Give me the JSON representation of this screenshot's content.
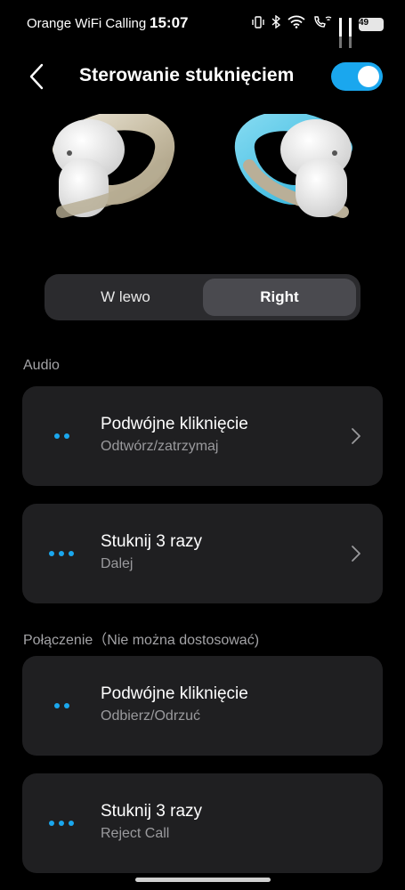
{
  "status_bar": {
    "carrier": "Orange WiFi Calling",
    "time": "15:07",
    "battery": "49"
  },
  "header": {
    "title": "Sterowanie stuknięciem",
    "toggle_on": true
  },
  "segmented": {
    "left_label": "W lewo",
    "right_label": "Right",
    "selected": "Right"
  },
  "sections": {
    "audio": "Audio",
    "connection": "Połączenie（Nie można dostosować)"
  },
  "audio_items": [
    {
      "title": "Podwójne kliknięcie",
      "value": "Odtwórz/zatrzymaj",
      "taps": 2
    },
    {
      "title": "Stuknij 3 razy",
      "value": "Dalej",
      "taps": 3
    }
  ],
  "connection_items": [
    {
      "title": "Podwójne kliknięcie",
      "value": "Odbierz/Odrzuć",
      "taps": 2
    },
    {
      "title": "Stuknij 3 razy",
      "value": "Reject Call",
      "taps": 3
    }
  ],
  "colors": {
    "accent": "#1aa7ee",
    "card": "#1f1f21",
    "background": "#000000"
  }
}
